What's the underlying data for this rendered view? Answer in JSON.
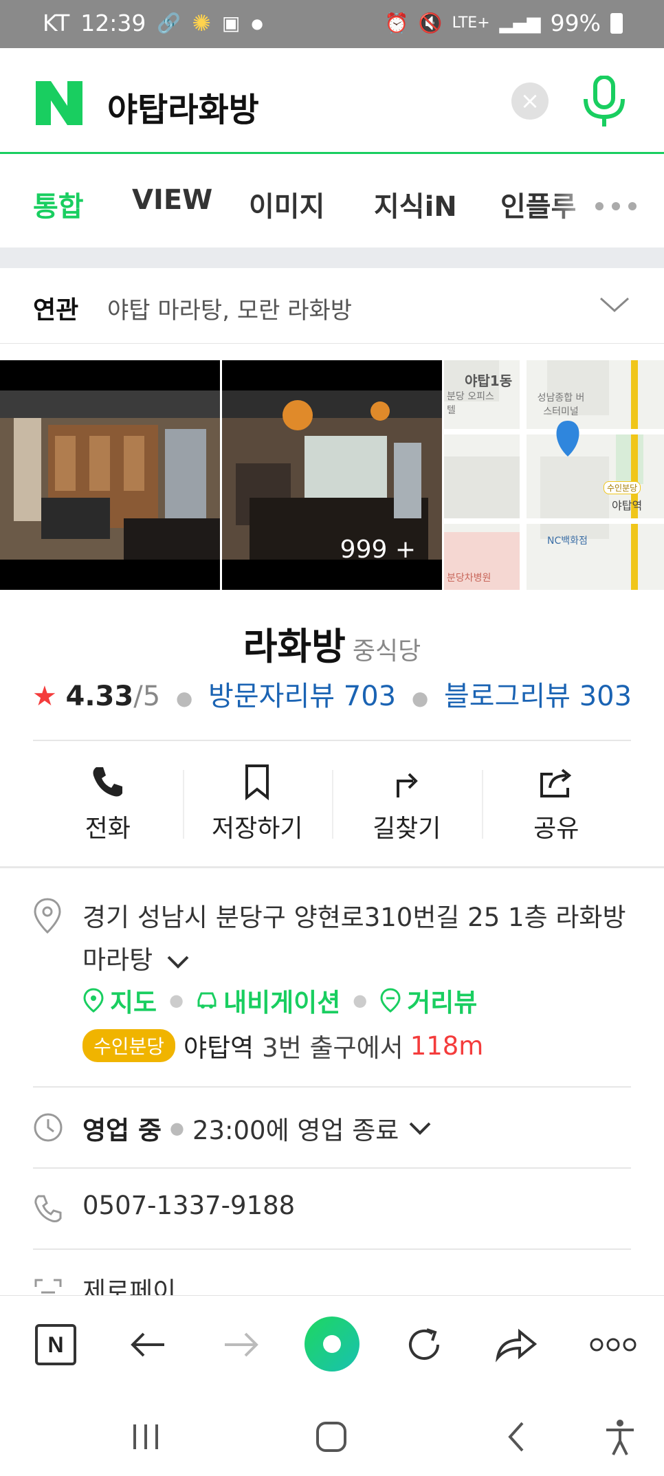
{
  "status_bar": {
    "carrier": "KT",
    "time": "12:39",
    "network": "LTE+",
    "battery": "99%"
  },
  "search": {
    "query": "야탑라화방",
    "clear_label": "×"
  },
  "tabs": [
    {
      "label": "통합",
      "active": true
    },
    {
      "label": "VIEW"
    },
    {
      "label": "이미지"
    },
    {
      "label": "지식iN"
    },
    {
      "label": "인플루"
    }
  ],
  "related": {
    "label": "연관",
    "terms": "야탑 마라탕, 모란 라화방"
  },
  "photos": {
    "count_label": "999 +"
  },
  "place": {
    "name": "라화방",
    "category": "중식당",
    "rating": "4.33",
    "rating_max": "/5",
    "visitor_reviews": "방문자리뷰 703",
    "blog_reviews": "블로그리뷰 303"
  },
  "actions": {
    "call": "전화",
    "save": "저장하기",
    "directions": "길찾기",
    "share": "공유"
  },
  "info": {
    "address": "경기 성남시 분당구 양현로310번길 25 1층 라화방마라탕",
    "links": {
      "map": "지도",
      "navigation": "내비게이션",
      "street_view": "거리뷰"
    },
    "station": {
      "line_badge": "수인분당",
      "station": "야탑역",
      "exit_text": "3번 출구에서",
      "distance": "118m"
    },
    "hours": {
      "status": "영업 중",
      "closing": "23:00에 영업 종료"
    },
    "phone": "0507-1337-9188",
    "zero_pay": "제로페이"
  },
  "map_labels": {
    "dong": "야탑1동",
    "office": "분당 오피스텔",
    "terminal": "성남종합 버스터미널",
    "line": "수인분당",
    "station": "야탑역",
    "dept": "NC백화점",
    "hospital": "분당차병원"
  },
  "colors": {
    "naver_green": "#19ce60",
    "link_blue": "#1a63b3",
    "accent_red": "#f43c3c",
    "line_yellow": "#f0b400"
  },
  "icons": [
    "search-logo-icon",
    "mic-icon",
    "pin-icon",
    "clock-icon",
    "phone-icon",
    "back-icon",
    "forward-icon",
    "refresh-icon",
    "share-icon",
    "more-icon"
  ]
}
